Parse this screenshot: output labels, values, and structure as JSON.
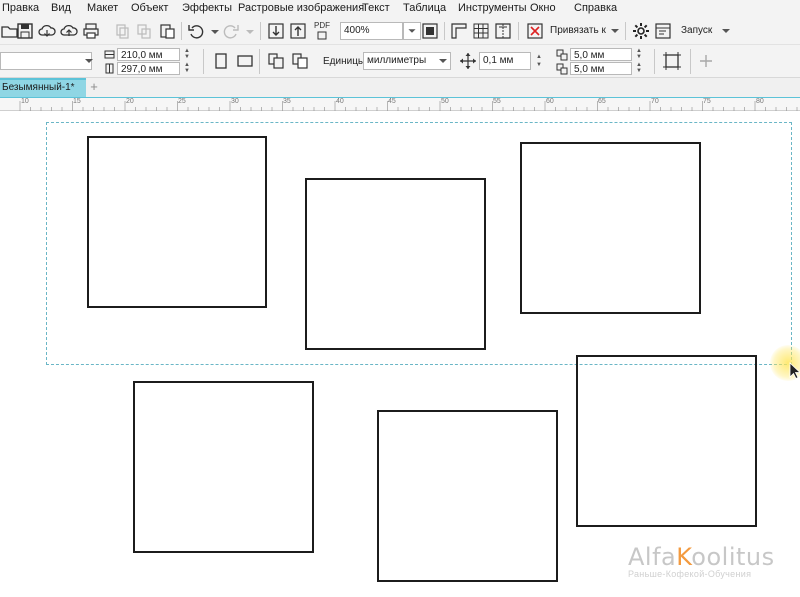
{
  "menu": {
    "items": [
      {
        "label": "Правка"
      },
      {
        "label": "Вид"
      },
      {
        "label": "Макет"
      },
      {
        "label": "Объект"
      },
      {
        "label": "Эффекты"
      },
      {
        "label": "Растровые изображения"
      },
      {
        "label": "Текст"
      },
      {
        "label": "Таблица"
      },
      {
        "label": "Инструменты"
      },
      {
        "label": "Окно"
      },
      {
        "label": "Справка"
      }
    ]
  },
  "standard_toolbar": {
    "pdf_label": "PDF",
    "zoom_value": "400%",
    "snap_label": "Привязать к",
    "launch_label": "Запуск"
  },
  "property_bar": {
    "page_width": "210,0 мм",
    "page_height": "297,0 мм",
    "units_label": "Единицы:",
    "units_value": "миллиметры",
    "nudge_value": "0,1 мм",
    "duplicate_x": "5,0 мм",
    "duplicate_y": "5,0 мм"
  },
  "document_tab": {
    "title": "Безымянный-1*",
    "add_symbol": "+"
  },
  "ruler": {
    "labels": [
      "10",
      "15",
      "20",
      "25",
      "30",
      "35",
      "40",
      "45",
      "50",
      "55",
      "60",
      "65",
      "70",
      "75",
      "80"
    ]
  },
  "watermark": {
    "brand_prefix": "Alfa",
    "brand_accent": "K",
    "brand_suffix": "oolitus",
    "tagline": "Раньше-Кофекой-Обучения"
  },
  "colors": {
    "accent_tab": "#8fd6e4",
    "selection_border": "#6ab6c6",
    "brand_orange": "#f39a3f"
  }
}
